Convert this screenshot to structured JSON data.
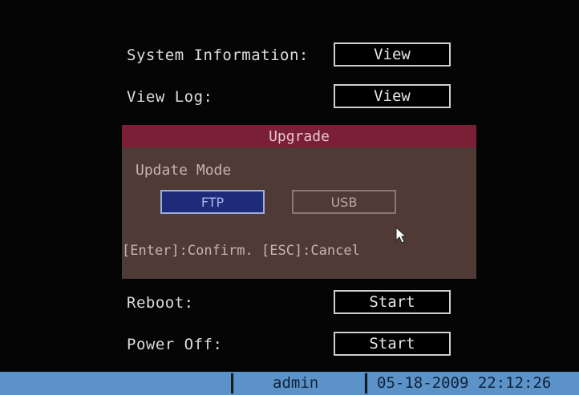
{
  "rows": {
    "system_information": {
      "label": "System Information:",
      "button": "View"
    },
    "view_log": {
      "label": "View Log:",
      "button": "View"
    },
    "reboot": {
      "label": "Reboot:",
      "button": "Start"
    },
    "power_off": {
      "label": "Power Off:",
      "button": "Start"
    }
  },
  "dialog": {
    "title": "Upgrade",
    "update_mode_label": "Update Mode",
    "modes": {
      "ftp": "FTP",
      "usb": "USB"
    },
    "hint": "[Enter]:Confirm. [ESC]:Cancel"
  },
  "statusbar": {
    "user": "admin",
    "datetime": "05-18-2009 22:12:26"
  },
  "colors": {
    "dialog_title_bg": "#7a1f35",
    "dialog_bg": "#4f3a35",
    "selected_mode_bg": "#1e2a7a",
    "statusbar_bg": "#4f86bd"
  }
}
